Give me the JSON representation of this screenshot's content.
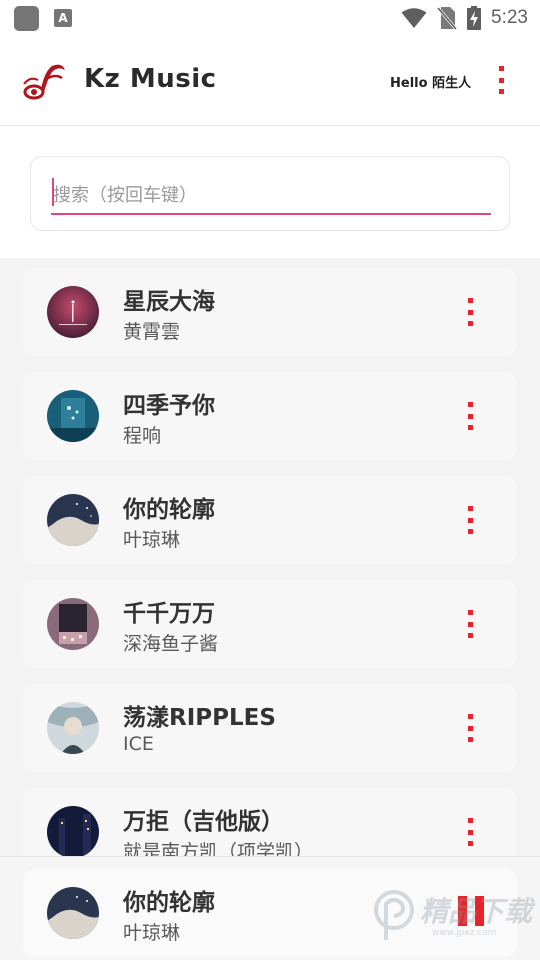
{
  "status_bar": {
    "app_badge": "A",
    "time": "5:23",
    "icons": [
      "app-square-icon",
      "text-input-icon",
      "wifi-icon",
      "no-sim-icon",
      "battery-charging-icon"
    ]
  },
  "app_bar": {
    "title": "Kz Music",
    "greeting": "Hello 陌生人",
    "logo": "music-note-logo",
    "menu_icon": "more-vert-icon"
  },
  "search": {
    "placeholder": "搜索（按回车键）",
    "value": ""
  },
  "songs": [
    {
      "title": "星辰大海",
      "artist": "黄霄雲",
      "cover": "starry-sea-cover"
    },
    {
      "title": "四季予你",
      "artist": "程响",
      "cover": "four-seasons-cover"
    },
    {
      "title": "你的轮廓",
      "artist": "叶琼琳",
      "cover": "outline-cover"
    },
    {
      "title": "千千万万",
      "artist": "深海鱼子酱",
      "cover": "city-night-cover"
    },
    {
      "title": "荡漾RIPPLES",
      "artist": "ICE",
      "cover": "ripples-cover"
    },
    {
      "title": "万拒（吉他版）",
      "artist": "就是南方凯（项学凯）",
      "cover": "guitar-cover"
    }
  ],
  "now_playing": {
    "title": "你的轮廓",
    "artist": "叶琼琳",
    "state_icon": "pause-icon"
  },
  "watermark": {
    "text": "精品下载",
    "url": "www.jpxz.com"
  },
  "colors": {
    "accent": "#e8232b",
    "search_underline": "#e0457d"
  }
}
